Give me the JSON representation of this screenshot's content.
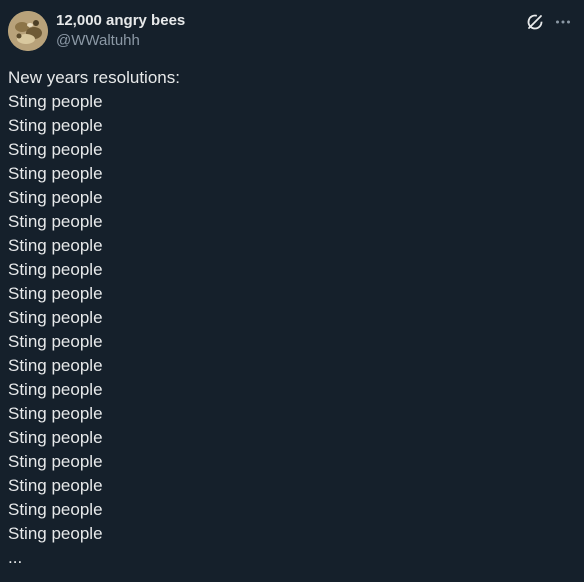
{
  "author": {
    "display_name": "12,000 angry bees",
    "handle": "@WWaltuhh"
  },
  "icons": {
    "grok": "grok-icon",
    "more": "more-icon"
  },
  "colors": {
    "background": "#15202b",
    "text": "#e7e9ea",
    "secondary": "#8b98a5"
  },
  "tweet": {
    "lines": [
      "New years resolutions:",
      "Sting people",
      "Sting people",
      "Sting people",
      "Sting people",
      "Sting people",
      "Sting people",
      "Sting people",
      "Sting people",
      "Sting people",
      "Sting people",
      "Sting people",
      "Sting people",
      "Sting people",
      "Sting people",
      "Sting people",
      "Sting people",
      "Sting people",
      "Sting people",
      "Sting people",
      "..."
    ]
  }
}
